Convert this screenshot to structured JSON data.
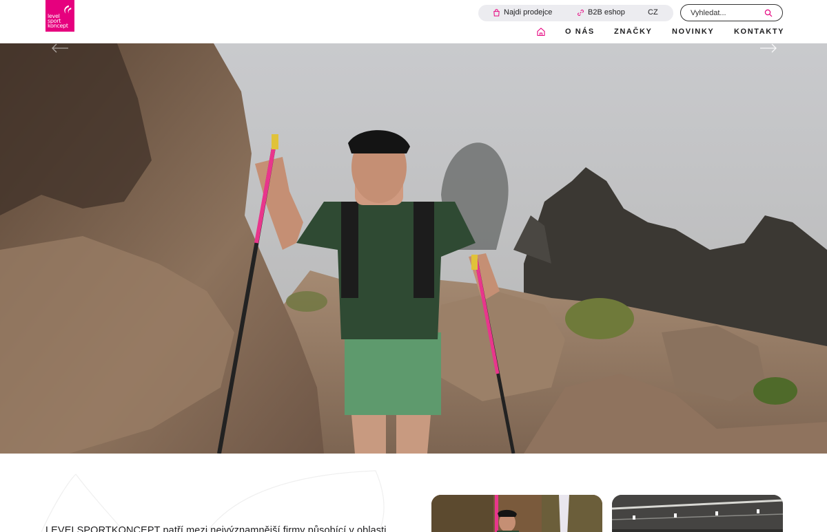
{
  "logo": {
    "line1": "level",
    "line2": "sport",
    "line3": "koncept"
  },
  "topbar": {
    "find_dealers": "Najdi prodejce",
    "b2b": "B2B eshop",
    "language": "CZ"
  },
  "search": {
    "placeholder": "Vyhledat..."
  },
  "nav": {
    "items": [
      {
        "label": "O NÁS"
      },
      {
        "label": "ZNAČKY"
      },
      {
        "label": "NOVINKY"
      },
      {
        "label": "KONTAKTY"
      }
    ]
  },
  "colors": {
    "brand": "#e6007e",
    "pill_bg": "#ececf0",
    "text": "#1d1d1f"
  },
  "icons": [
    "home-icon",
    "bag-icon",
    "link-icon",
    "search-icon",
    "arrow-left-icon",
    "arrow-right-icon"
  ],
  "intro": {
    "text": "LEVELSPORTKONCEPT patří mezi nejvýznamnější firmy působící v oblasti"
  }
}
